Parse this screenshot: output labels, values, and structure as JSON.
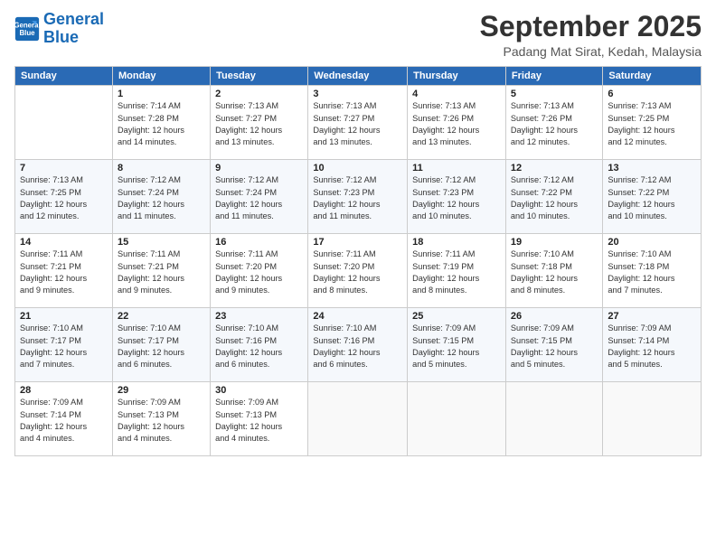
{
  "logo": {
    "line1": "General",
    "line2": "Blue"
  },
  "header": {
    "title": "September 2025",
    "subtitle": "Padang Mat Sirat, Kedah, Malaysia"
  },
  "weekdays": [
    "Sunday",
    "Monday",
    "Tuesday",
    "Wednesday",
    "Thursday",
    "Friday",
    "Saturday"
  ],
  "weeks": [
    [
      {
        "day": "",
        "info": ""
      },
      {
        "day": "1",
        "info": "Sunrise: 7:14 AM\nSunset: 7:28 PM\nDaylight: 12 hours\nand 14 minutes."
      },
      {
        "day": "2",
        "info": "Sunrise: 7:13 AM\nSunset: 7:27 PM\nDaylight: 12 hours\nand 13 minutes."
      },
      {
        "day": "3",
        "info": "Sunrise: 7:13 AM\nSunset: 7:27 PM\nDaylight: 12 hours\nand 13 minutes."
      },
      {
        "day": "4",
        "info": "Sunrise: 7:13 AM\nSunset: 7:26 PM\nDaylight: 12 hours\nand 13 minutes."
      },
      {
        "day": "5",
        "info": "Sunrise: 7:13 AM\nSunset: 7:26 PM\nDaylight: 12 hours\nand 12 minutes."
      },
      {
        "day": "6",
        "info": "Sunrise: 7:13 AM\nSunset: 7:25 PM\nDaylight: 12 hours\nand 12 minutes."
      }
    ],
    [
      {
        "day": "7",
        "info": "Sunrise: 7:13 AM\nSunset: 7:25 PM\nDaylight: 12 hours\nand 12 minutes."
      },
      {
        "day": "8",
        "info": "Sunrise: 7:12 AM\nSunset: 7:24 PM\nDaylight: 12 hours\nand 11 minutes."
      },
      {
        "day": "9",
        "info": "Sunrise: 7:12 AM\nSunset: 7:24 PM\nDaylight: 12 hours\nand 11 minutes."
      },
      {
        "day": "10",
        "info": "Sunrise: 7:12 AM\nSunset: 7:23 PM\nDaylight: 12 hours\nand 11 minutes."
      },
      {
        "day": "11",
        "info": "Sunrise: 7:12 AM\nSunset: 7:23 PM\nDaylight: 12 hours\nand 10 minutes."
      },
      {
        "day": "12",
        "info": "Sunrise: 7:12 AM\nSunset: 7:22 PM\nDaylight: 12 hours\nand 10 minutes."
      },
      {
        "day": "13",
        "info": "Sunrise: 7:12 AM\nSunset: 7:22 PM\nDaylight: 12 hours\nand 10 minutes."
      }
    ],
    [
      {
        "day": "14",
        "info": "Sunrise: 7:11 AM\nSunset: 7:21 PM\nDaylight: 12 hours\nand 9 minutes."
      },
      {
        "day": "15",
        "info": "Sunrise: 7:11 AM\nSunset: 7:21 PM\nDaylight: 12 hours\nand 9 minutes."
      },
      {
        "day": "16",
        "info": "Sunrise: 7:11 AM\nSunset: 7:20 PM\nDaylight: 12 hours\nand 9 minutes."
      },
      {
        "day": "17",
        "info": "Sunrise: 7:11 AM\nSunset: 7:20 PM\nDaylight: 12 hours\nand 8 minutes."
      },
      {
        "day": "18",
        "info": "Sunrise: 7:11 AM\nSunset: 7:19 PM\nDaylight: 12 hours\nand 8 minutes."
      },
      {
        "day": "19",
        "info": "Sunrise: 7:10 AM\nSunset: 7:18 PM\nDaylight: 12 hours\nand 8 minutes."
      },
      {
        "day": "20",
        "info": "Sunrise: 7:10 AM\nSunset: 7:18 PM\nDaylight: 12 hours\nand 7 minutes."
      }
    ],
    [
      {
        "day": "21",
        "info": "Sunrise: 7:10 AM\nSunset: 7:17 PM\nDaylight: 12 hours\nand 7 minutes."
      },
      {
        "day": "22",
        "info": "Sunrise: 7:10 AM\nSunset: 7:17 PM\nDaylight: 12 hours\nand 6 minutes."
      },
      {
        "day": "23",
        "info": "Sunrise: 7:10 AM\nSunset: 7:16 PM\nDaylight: 12 hours\nand 6 minutes."
      },
      {
        "day": "24",
        "info": "Sunrise: 7:10 AM\nSunset: 7:16 PM\nDaylight: 12 hours\nand 6 minutes."
      },
      {
        "day": "25",
        "info": "Sunrise: 7:09 AM\nSunset: 7:15 PM\nDaylight: 12 hours\nand 5 minutes."
      },
      {
        "day": "26",
        "info": "Sunrise: 7:09 AM\nSunset: 7:15 PM\nDaylight: 12 hours\nand 5 minutes."
      },
      {
        "day": "27",
        "info": "Sunrise: 7:09 AM\nSunset: 7:14 PM\nDaylight: 12 hours\nand 5 minutes."
      }
    ],
    [
      {
        "day": "28",
        "info": "Sunrise: 7:09 AM\nSunset: 7:14 PM\nDaylight: 12 hours\nand 4 minutes."
      },
      {
        "day": "29",
        "info": "Sunrise: 7:09 AM\nSunset: 7:13 PM\nDaylight: 12 hours\nand 4 minutes."
      },
      {
        "day": "30",
        "info": "Sunrise: 7:09 AM\nSunset: 7:13 PM\nDaylight: 12 hours\nand 4 minutes."
      },
      {
        "day": "",
        "info": ""
      },
      {
        "day": "",
        "info": ""
      },
      {
        "day": "",
        "info": ""
      },
      {
        "day": "",
        "info": ""
      }
    ]
  ]
}
